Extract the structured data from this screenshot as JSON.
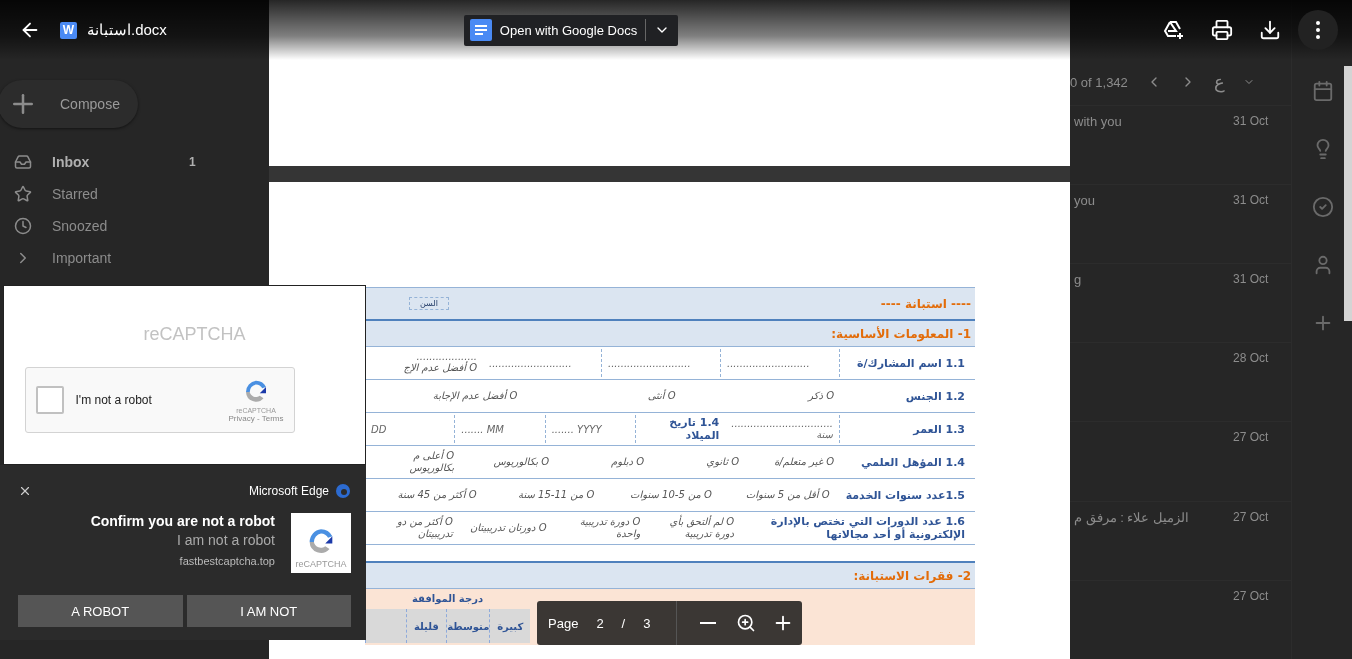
{
  "viewer": {
    "file_icon": "W",
    "file_name": "استبانة.docx",
    "open_with": "Open with Google Docs"
  },
  "gmail": {
    "compose": "Compose",
    "nav": [
      {
        "label": "Inbox",
        "count": "1",
        "selected": true
      },
      {
        "label": "Starred",
        "selected": false
      },
      {
        "label": "Snoozed",
        "selected": false
      },
      {
        "label": "Important",
        "selected": false
      }
    ],
    "pagination": "0 of 1,342",
    "input_tool": "ع",
    "rows": [
      {
        "snippet": "with you",
        "date": "31 Oct"
      },
      {
        "snippet": "you",
        "date": "31 Oct"
      },
      {
        "snippet": "g",
        "date": "31 Oct"
      },
      {
        "date": "28 Oct"
      },
      {
        "date": "27 Oct"
      },
      {
        "snippet": "الزميل علاء : مرفق م",
        "date": "27 Oct"
      },
      {
        "date": "27 Oct"
      }
    ]
  },
  "document": {
    "title": "---- استبانة ----",
    "tag": "السن",
    "section_1": "1- المعلومات الأساسية:",
    "rows": [
      {
        "label": "1.1 اسم المشارك/ة",
        "answers": [
          {
            "kind": "field",
            "text": ".........................."
          },
          {
            "kind": "field",
            "text": ".........................."
          },
          {
            "kind": "field",
            "text": ".........................."
          },
          {
            "kind": "option",
            "note": "...................",
            "text": "O أفضل عدم الإج"
          }
        ]
      },
      {
        "label": "1.2 الجنس",
        "answers": [
          {
            "kind": "option",
            "text": "O ذكر"
          },
          {
            "kind": "option",
            "text": "O أنثى"
          },
          {
            "kind": "option",
            "text": "O أفضل عدم الإجابة"
          }
        ]
      },
      {
        "label": "1.3 العمر",
        "answers": [
          {
            "kind": "field",
            "text": "................................ سنة"
          },
          {
            "kind": "label",
            "text": "1.4 تاريخ الميلاد"
          },
          {
            "kind": "field",
            "text": "....... YYYY"
          },
          {
            "kind": "field",
            "text": "....... MM"
          },
          {
            "kind": "field",
            "text": "DD"
          }
        ]
      },
      {
        "label": "1.4 المؤهل العلمي",
        "answers": [
          {
            "kind": "option",
            "text": "O غير متعلم/ة"
          },
          {
            "kind": "option",
            "text": "O ثانوي"
          },
          {
            "kind": "option",
            "text": "O دبلوم"
          },
          {
            "kind": "option",
            "text": "O بكالوريوس"
          },
          {
            "kind": "option",
            "text": "O أعلى م بكالوريوس"
          }
        ]
      },
      {
        "label": "1.5عدد سنوات الخدمة",
        "answers": [
          {
            "kind": "option",
            "text": "O أقل من 5 سنوات"
          },
          {
            "kind": "option",
            "text": "O من 5-10 سنوات"
          },
          {
            "kind": "option",
            "text": "O من 11-15 سنة"
          },
          {
            "kind": "option",
            "text": "O أكثر من 45 سنة"
          }
        ]
      },
      {
        "label": "1.6 عدد الدورات التي تختص بالإدارة الإلكترونية أو أحد مجالاتها",
        "answers": [
          {
            "kind": "option",
            "text": "O لم ألتحق بأي دورة تدريبية"
          },
          {
            "kind": "option",
            "text": "O دورة تدريبية واحدة"
          },
          {
            "kind": "option",
            "text": "O دورتان تدريبيتان"
          },
          {
            "kind": "option",
            "text": "O أكثر من دو تدريبيتان"
          }
        ]
      }
    ],
    "section_2": "2- فقرات الاستبانة:",
    "agreement": "درجة الموافقة",
    "scale": [
      "كبيرة",
      "متوسطة",
      "قليلة"
    ]
  },
  "pager": {
    "label": "Page",
    "current": "2",
    "separator": "/",
    "total": "3"
  },
  "captcha": {
    "logo_text": "reCAPTCHA",
    "checkbox": {
      "label": "I'm not a robot",
      "checked": false
    },
    "badge": "reCAPTCHA",
    "links": "Privacy - Terms"
  },
  "toast": {
    "app": "Microsoft Edge",
    "title": "Confirm you are not a robot",
    "message": "I am not a robot",
    "site": "fastbestcaptcha.top",
    "image_caption": "reCAPTCHA",
    "robot_button": "A ROBOT",
    "human_button": "I AM NOT"
  }
}
